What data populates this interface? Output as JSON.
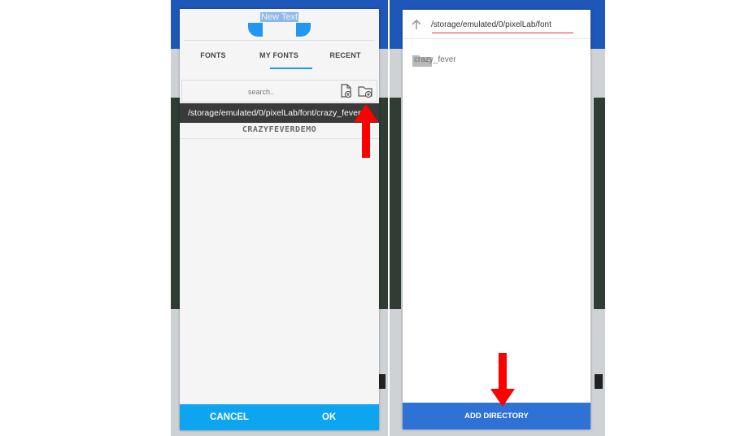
{
  "left_dialog": {
    "selected_text": "New Text",
    "tabs": [
      {
        "label": "FONTS"
      },
      {
        "label": "MY FONTS"
      },
      {
        "label": "RECENT"
      }
    ],
    "search_placeholder": "search..",
    "path": "/storage/emulated/0/pixelLab/font/crazy_fever",
    "font_sample": "CRAZYFEVERDEMO",
    "cancel_label": "CANCEL",
    "ok_label": "OK"
  },
  "right_dialog": {
    "path_value": "/storage/emulated/0/pixelLab/font",
    "folders": [
      {
        "name": "crazy_fever"
      }
    ],
    "add_directory_label": "ADD DIRECTORY"
  },
  "colors": {
    "accent_blue": "#2196f3",
    "button_bar": "#0ea5f0",
    "add_directory_bar": "#2f72d6",
    "annotation_arrow": "#ff0000",
    "path_underline": "#e53935"
  },
  "icons": [
    "new-file-icon",
    "new-folder-icon",
    "arrow-up-icon",
    "folder-icon"
  ]
}
